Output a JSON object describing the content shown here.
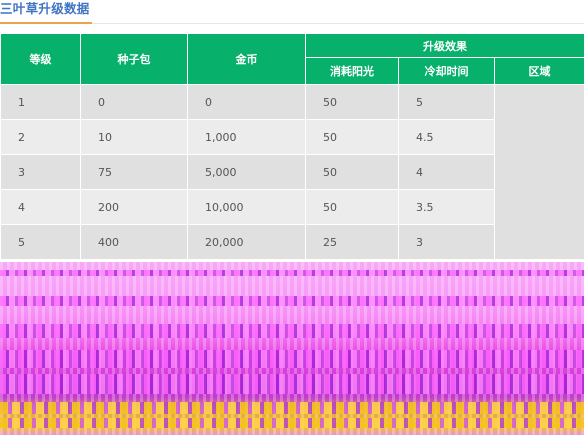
{
  "section": {
    "title": "三叶草升级数据"
  },
  "table": {
    "headers": {
      "level": "等级",
      "seed_pack": "种子包",
      "gold": "金币",
      "effect_group": "升级效果",
      "sun_cost": "消耗阳光",
      "cooldown": "冷却时间",
      "region": "区域"
    },
    "rows": [
      {
        "level": "1",
        "seed_pack": "0",
        "gold": "0",
        "sun_cost": "50",
        "cooldown": "5"
      },
      {
        "level": "2",
        "seed_pack": "10",
        "gold": "1,000",
        "sun_cost": "50",
        "cooldown": "4.5"
      },
      {
        "level": "3",
        "seed_pack": "75",
        "gold": "5,000",
        "sun_cost": "50",
        "cooldown": "4"
      },
      {
        "level": "4",
        "seed_pack": "200",
        "gold": "10,000",
        "sun_cost": "50",
        "cooldown": "3.5"
      },
      {
        "level": "5",
        "seed_pack": "400",
        "gold": "20,000",
        "sun_cost": "25",
        "cooldown": "3"
      }
    ]
  },
  "colors": {
    "header_bg": "#07b06b",
    "title_text": "#3f74c2",
    "title_underline": "#f0a24a",
    "row_dark": "#e0e0e0",
    "row_light": "#ececec"
  }
}
